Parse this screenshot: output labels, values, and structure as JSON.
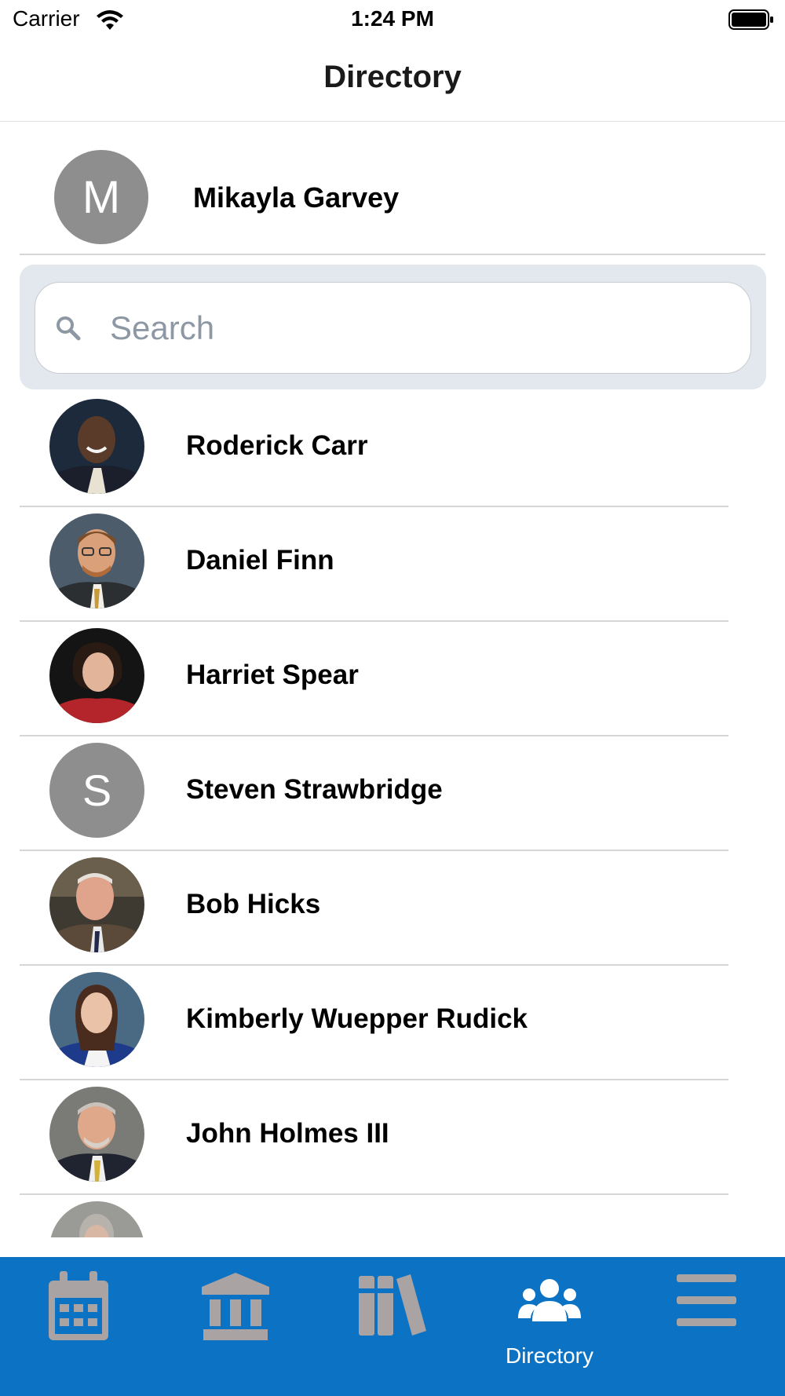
{
  "status_bar": {
    "carrier": "Carrier",
    "time": "1:24 PM"
  },
  "nav": {
    "title": "Directory"
  },
  "current_user": {
    "initial": "M",
    "name": "Mikayla Garvey"
  },
  "search": {
    "placeholder": "Search",
    "value": ""
  },
  "directory": {
    "items": [
      {
        "name": "Roderick Carr",
        "avatar": "photo"
      },
      {
        "name": "Daniel Finn",
        "avatar": "photo"
      },
      {
        "name": "Harriet Spear",
        "avatar": "photo"
      },
      {
        "name": "Steven Strawbridge",
        "avatar": "initial",
        "initial": "S"
      },
      {
        "name": "Bob Hicks",
        "avatar": "photo"
      },
      {
        "name": "Kimberly Wuepper Rudick",
        "avatar": "photo"
      },
      {
        "name": "John Holmes III",
        "avatar": "photo"
      },
      {
        "name": "",
        "avatar": "photo"
      }
    ]
  },
  "tab_bar": {
    "tabs": [
      {
        "icon": "calendar-icon",
        "label": "",
        "active": false
      },
      {
        "icon": "institution-icon",
        "label": "",
        "active": false
      },
      {
        "icon": "library-icon",
        "label": "",
        "active": false
      },
      {
        "icon": "users-icon",
        "label": "Directory",
        "active": true
      },
      {
        "icon": "menu-icon",
        "label": "",
        "active": false
      }
    ]
  },
  "colors": {
    "tab_bar": "#0b72c4",
    "inactive_icon": "#a9a3a3",
    "active_icon": "#ffffff",
    "avatar_placeholder": "#8e8e8e",
    "search_container": "#e3e8ee"
  }
}
